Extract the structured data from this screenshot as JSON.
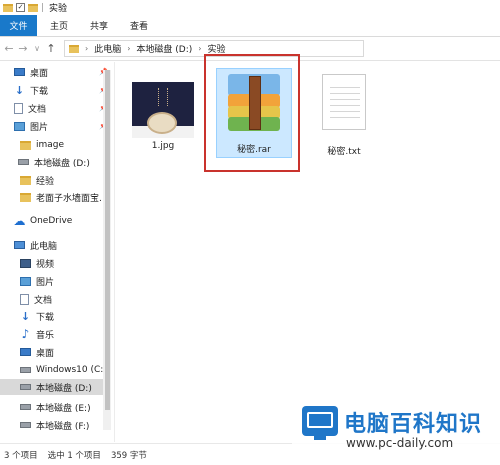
{
  "window": {
    "title": "实验"
  },
  "ribbon": {
    "tabs": [
      "文件",
      "主页",
      "共享",
      "查看"
    ]
  },
  "address": {
    "crumbs": [
      "此电脑",
      "本地磁盘 (D:)",
      "实验"
    ]
  },
  "sidebar": {
    "items": [
      {
        "label": "桌面",
        "icon": "desktop-icon",
        "pinned": true
      },
      {
        "label": "下载",
        "icon": "download-icon",
        "pinned": true
      },
      {
        "label": "文档",
        "icon": "document-icon",
        "pinned": true
      },
      {
        "label": "图片",
        "icon": "pictures-icon",
        "pinned": true
      },
      {
        "label": "image",
        "icon": "folder-icon"
      },
      {
        "label": "本地磁盘 (D:)",
        "icon": "drive-icon"
      },
      {
        "label": "经验",
        "icon": "folder-icon"
      },
      {
        "label": "老面子水墙面宝.",
        "icon": "folder-icon"
      },
      {
        "label": "OneDrive",
        "icon": "onedrive-icon"
      },
      {
        "label": "此电脑",
        "icon": "this-pc-icon"
      },
      {
        "label": "视频",
        "icon": "video-icon"
      },
      {
        "label": "图片",
        "icon": "pictures-icon"
      },
      {
        "label": "文档",
        "icon": "document-icon"
      },
      {
        "label": "下载",
        "icon": "download-icon"
      },
      {
        "label": "音乐",
        "icon": "music-icon"
      },
      {
        "label": "桌面",
        "icon": "desktop-icon"
      },
      {
        "label": "Windows10 (C:",
        "icon": "drive-icon"
      },
      {
        "label": "本地磁盘 (D:)",
        "icon": "drive-icon",
        "selected": true
      },
      {
        "label": "本地磁盘 (E:)",
        "icon": "drive-icon"
      },
      {
        "label": "本地磁盘 (F:)",
        "icon": "drive-icon"
      }
    ]
  },
  "files": [
    {
      "name": "1.jpg",
      "icon": "jpg-thumbnail"
    },
    {
      "name": "秘密.rar",
      "icon": "rar-archive-icon",
      "selected": true
    },
    {
      "name": "秘密.txt",
      "icon": "text-file-icon"
    }
  ],
  "status": {
    "count": "3 个项目",
    "selected": "选中 1 个项目",
    "size": "359 字节"
  },
  "watermark": {
    "name": "电脑百科知识",
    "url": "www.pc-daily.com"
  },
  "colors": {
    "accent": "#1979ca",
    "selection": "#cce8ff",
    "highlight_box": "#c9332d",
    "watermark_blue": "#1f76c8"
  }
}
